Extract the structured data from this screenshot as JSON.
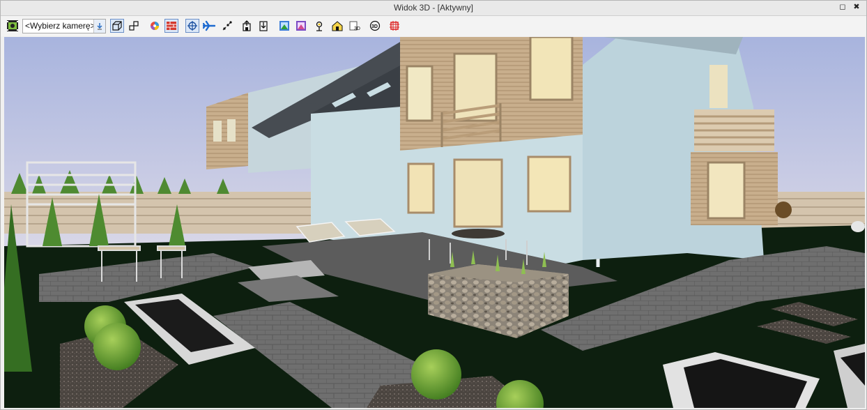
{
  "window": {
    "title": "Widok 3D - [Aktywny]",
    "restore_glyph": "◻",
    "close_glyph": "✖"
  },
  "toolbar": {
    "camera_select_value": "<Wybierz kamerę>",
    "tools": [
      {
        "id": "camera-settings",
        "icon": "camera-film-icon"
      },
      {
        "id": "camera-dropdown",
        "icon": "chevron-down-icon"
      },
      {
        "id": "perspective-view",
        "icon": "perspective-box-icon",
        "pressed": true
      },
      {
        "id": "axonometric-view",
        "icon": "axonometric-box-icon"
      },
      {
        "id": "color-palette",
        "icon": "color-wheel-icon"
      },
      {
        "id": "wall-texture",
        "icon": "brick-wall-icon",
        "pressed": true
      },
      {
        "id": "navigation",
        "icon": "target-crosshair-icon",
        "pressed": true
      },
      {
        "id": "fly-mode",
        "icon": "airplane-icon"
      },
      {
        "id": "walk-path",
        "icon": "path-dots-icon"
      },
      {
        "id": "floor-up",
        "icon": "building-up-icon"
      },
      {
        "id": "floor-down",
        "icon": "building-down-icon"
      },
      {
        "id": "render-1",
        "icon": "render-scene-icon"
      },
      {
        "id": "render-2",
        "icon": "render-scene-alt-icon"
      },
      {
        "id": "sun-settings",
        "icon": "sun-person-icon"
      },
      {
        "id": "house-lights",
        "icon": "house-light-icon"
      },
      {
        "id": "export-3d",
        "icon": "export-3d-icon"
      },
      {
        "id": "rotate-3d",
        "icon": "rotate-3d-icon"
      },
      {
        "id": "section-plane",
        "icon": "section-frame-icon"
      }
    ]
  },
  "colors": {
    "sky_top": "#a8b4de",
    "sky_bottom": "#e8e2ea",
    "lawn": "#0d1f0f",
    "paving": "#6c6c6c",
    "facade": "#c9dde3",
    "wood": "#c8ae8c",
    "roof": "#474c52",
    "accent_blue": "#2a6fc2"
  }
}
